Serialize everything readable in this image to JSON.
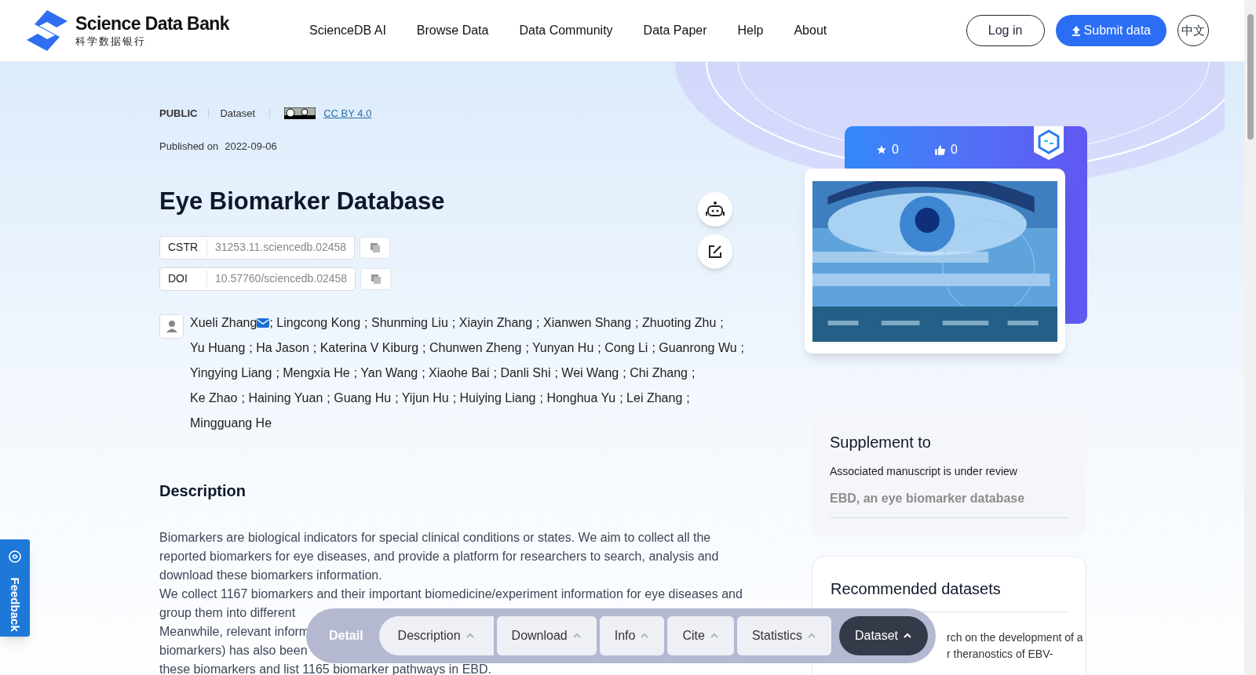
{
  "header": {
    "logo_title": "Science Data Bank",
    "logo_subtitle": "科学数据银行",
    "nav": [
      "ScienceDB AI",
      "Browse Data",
      "Data Community",
      "Data Paper",
      "Help",
      "About"
    ],
    "login": "Log in",
    "submit": "Submit data",
    "language": "中文"
  },
  "meta": {
    "visibility": "PUBLIC",
    "type": "Dataset",
    "license": "CC BY 4.0",
    "published_label": "Published on",
    "published_date": "2022-09-06"
  },
  "title": "Eye Biomarker Database",
  "identifiers": [
    {
      "label": "CSTR",
      "value": "31253.11.sciencedb.02458"
    },
    {
      "label": "DOI",
      "value": "10.57760/sciencedb.02458"
    }
  ],
  "author_separator": ";",
  "authors": [
    {
      "name": "Xueli Zhang",
      "email": true
    },
    {
      "name": "Lingcong Kong",
      "email": false
    },
    {
      "name": "Shunming Liu",
      "email": false
    },
    {
      "name": "Xiayin Zhang",
      "email": false
    },
    {
      "name": "Xianwen Shang",
      "email": false
    },
    {
      "name": "Zhuoting Zhu",
      "email": false
    },
    {
      "name": "Yu Huang",
      "email": false
    },
    {
      "name": "Ha Jason",
      "email": false
    },
    {
      "name": "Katerina V Kiburg",
      "email": false
    },
    {
      "name": "Chunwen Zheng",
      "email": false
    },
    {
      "name": "Yunyan Hu",
      "email": false
    },
    {
      "name": "Cong Li",
      "email": false
    },
    {
      "name": "Guanrong Wu",
      "email": false
    },
    {
      "name": "Yingying Liang",
      "email": false
    },
    {
      "name": "Mengxia He",
      "email": false
    },
    {
      "name": "Yan Wang",
      "email": false
    },
    {
      "name": "Xiaohe Bai",
      "email": false
    },
    {
      "name": "Danli Shi",
      "email": false
    },
    {
      "name": "Wei Wang",
      "email": false
    },
    {
      "name": "Chi Zhang",
      "email": false
    },
    {
      "name": "Ke Zhao",
      "email": false
    },
    {
      "name": "Haining Yuan",
      "email": false
    },
    {
      "name": "Guang Hu",
      "email": false
    },
    {
      "name": "Yijun Hu",
      "email": false
    },
    {
      "name": "Huiying Liang",
      "email": false
    },
    {
      "name": "Honghua Yu",
      "email": false
    },
    {
      "name": "Lei Zhang",
      "email": false
    },
    {
      "name": "Mingguang He",
      "email": false
    }
  ],
  "description": {
    "heading": "Description",
    "lines": [
      "Biomarkers are biological indicators for special clinical conditions or states. We aim to collect all the",
      "reported biomarkers for eye diseases, and provide a platform for researchers to search, analysis and",
      "download these biomarkers information.",
      "We collect 1167 biomarkers and their important biomedicine/experiment information for eye diseases and",
      "group them into different",
      "Meanwhile, relevant inform",
      "biomarkers) has also been",
      "these biomarkers and list 1165 biomarker pathways in EBD."
    ]
  },
  "stats": {
    "stars": "0",
    "likes": "0"
  },
  "supplement": {
    "title": "Supplement to",
    "note": "Associated manuscript is under review",
    "link": "EBD, an eye biomarker database"
  },
  "recommended": {
    "title": "Recommended datasets",
    "lines": [
      "rch on the development of a",
      "r theranostics of EBV-"
    ]
  },
  "section_nav": {
    "label": "Detail",
    "items": [
      {
        "label": "Description",
        "selected": false
      },
      {
        "label": "Download",
        "selected": false
      },
      {
        "label": "Info",
        "selected": false
      },
      {
        "label": "Cite",
        "selected": false
      },
      {
        "label": "Statistics",
        "selected": false
      },
      {
        "label": "Dataset",
        "selected": true
      }
    ]
  },
  "feedback": "Feedback"
}
